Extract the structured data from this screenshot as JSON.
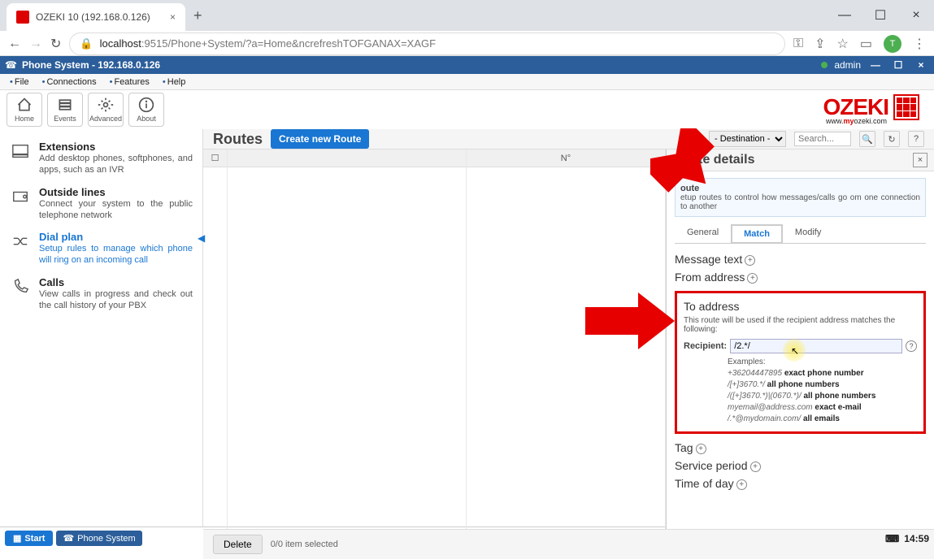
{
  "browser": {
    "tab_title": "OZEKI 10 (192.168.0.126)",
    "url_host": "localhost",
    "url_port": ":9515",
    "url_path": "/Phone+System/?a=Home&ncrefreshTOFGANAX=XAGF",
    "avatar_letter": "T"
  },
  "app_title": "Phone System - 192.168.0.126",
  "app_user": "admin",
  "menu": [
    "File",
    "Connections",
    "Features",
    "Help"
  ],
  "toolbar": [
    {
      "label": "Home"
    },
    {
      "label": "Events"
    },
    {
      "label": "Advanced"
    },
    {
      "label": "About"
    }
  ],
  "logo": {
    "text": "OZEKI",
    "url_prefix": "www.",
    "url_my": "my",
    "url_suffix": "ozeki.com"
  },
  "sidebar": [
    {
      "title": "Extensions",
      "desc": "Add desktop phones, softphones, and apps, such as an IVR",
      "active": false
    },
    {
      "title": "Outside lines",
      "desc": "Connect your system to the public telephone network",
      "active": false
    },
    {
      "title": "Dial plan",
      "desc": "Setup rules to manage which phone will ring on an incoming call",
      "active": true
    },
    {
      "title": "Calls",
      "desc": "View calls in progress and check out the call history of your PBX",
      "active": false
    }
  ],
  "content_title": "Routes",
  "create_btn": "Create new Route",
  "dest_placeholder": "- Destination -",
  "search_placeholder": "Search...",
  "table_col_name": "N°",
  "details": {
    "title": "Route details",
    "info_title": "oute",
    "info_desc": "etup routes to control how messages/calls go om one connection to another",
    "tabs": [
      "General",
      "Match",
      "Modify"
    ],
    "active_tab": 1,
    "sections": {
      "msg_text": "Message text",
      "from_addr": "From address",
      "to_addr_title": "To address",
      "to_addr_desc": "This route will be used if the recipient address matches the following:",
      "recipient_label": "Recipient:",
      "recipient_value": "/2.*/",
      "examples_label": "Examples:",
      "ex1_val": "+36204447895",
      "ex1_desc": "exact phone number",
      "ex2_val": "/[+]3670.*/",
      "ex2_desc": "all phone numbers",
      "ex3_val": "/([+]3670.*)|(0670.*)/",
      "ex3_desc": "all phone numbers",
      "ex4_val": "myemail@address.com",
      "ex4_desc": "exact e-mail",
      "ex5_val": "/.*@mydomain.com/",
      "ex5_desc": "all emails",
      "tag": "Tag",
      "service": "Service period",
      "tod": "Time of day"
    }
  },
  "delete_btn": "Delete",
  "selection_text": "0/0 item selected",
  "taskbar": {
    "start": "Start",
    "phone_sys": "Phone System",
    "time": "14:59"
  }
}
